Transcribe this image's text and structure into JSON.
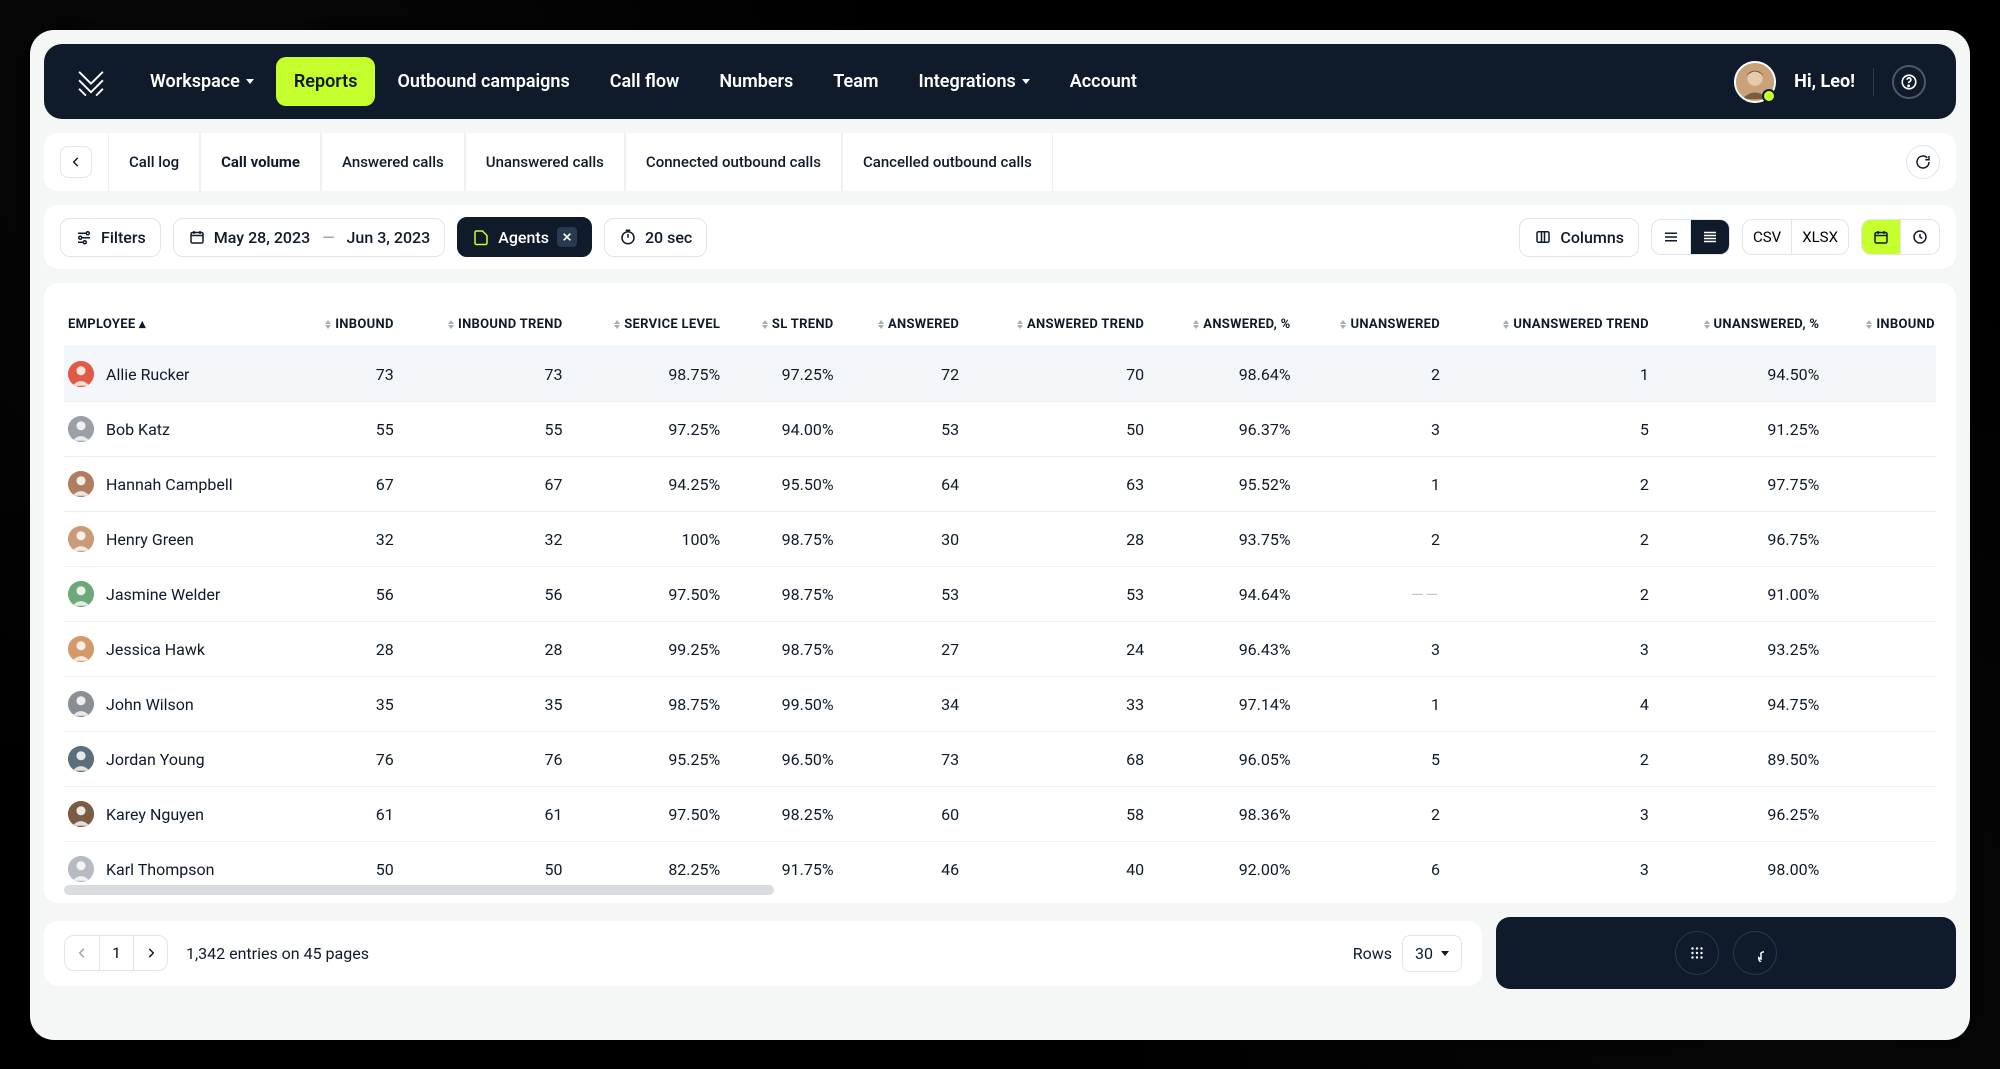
{
  "topnav": {
    "items": [
      {
        "label": "Workspace",
        "hasChevron": true
      },
      {
        "label": "Reports",
        "active": true
      },
      {
        "label": "Outbound campaigns"
      },
      {
        "label": "Call flow"
      },
      {
        "label": "Numbers"
      },
      {
        "label": "Team"
      },
      {
        "label": "Integrations",
        "hasChevron": true
      },
      {
        "label": "Account"
      }
    ],
    "greeting": "Hi, Leo!"
  },
  "tabs": [
    {
      "label": "Call log"
    },
    {
      "label": "Call volume",
      "active": true
    },
    {
      "label": "Answered calls"
    },
    {
      "label": "Unanswered calls"
    },
    {
      "label": "Connected outbound calls"
    },
    {
      "label": "Cancelled outbound calls"
    }
  ],
  "filters": {
    "filters_label": "Filters",
    "date_from": "May 28, 2023",
    "date_to": "Jun 3, 2023",
    "agents_label": "Agents",
    "duration_label": "20 sec",
    "columns_label": "Columns",
    "export": {
      "csv": "CSV",
      "xlsx": "XLSX"
    }
  },
  "table": {
    "columns": [
      {
        "key": "employee",
        "label": "EMPLOYEE",
        "sorted": true
      },
      {
        "key": "inbound",
        "label": "INBOUND"
      },
      {
        "key": "inbound_trend",
        "label": "INBOUND TREND"
      },
      {
        "key": "service_level",
        "label": "SERVICE LEVEL"
      },
      {
        "key": "sl_trend",
        "label": "SL TREND"
      },
      {
        "key": "answered",
        "label": "ANSWERED"
      },
      {
        "key": "answered_trend",
        "label": "ANSWERED TREND"
      },
      {
        "key": "answered_pct",
        "label": "ANSWERED, %"
      },
      {
        "key": "unanswered",
        "label": "UNANSWERED"
      },
      {
        "key": "unanswered_trend",
        "label": "UNANSWERED TREND"
      },
      {
        "key": "unanswered_pct",
        "label": "UNANSWERED, %"
      },
      {
        "key": "inbound_cc",
        "label": "INBOUND CC"
      }
    ],
    "rows": [
      {
        "employee": "Allie Rucker",
        "hue": "#e05a47",
        "inbound": 73,
        "inbound_trend": 73,
        "service_level": "98.75%",
        "sl_trend": "97.25%",
        "answered": 72,
        "answered_trend": 70,
        "answered_pct": "98.64%",
        "unanswered": 2,
        "unanswered_trend": "1",
        "unanswered_pct": "94.50%"
      },
      {
        "employee": "Bob Katz",
        "hue": "#9aa0a6",
        "inbound": 55,
        "inbound_trend": 55,
        "service_level": "97.25%",
        "sl_trend": "94.00%",
        "answered": 53,
        "answered_trend": 50,
        "answered_pct": "96.37%",
        "unanswered": 3,
        "unanswered_trend": "5",
        "unanswered_pct": "91.25%"
      },
      {
        "employee": "Hannah Campbell",
        "hue": "#b07d62",
        "inbound": 67,
        "inbound_trend": 67,
        "service_level": "94.25%",
        "sl_trend": "95.50%",
        "answered": 64,
        "answered_trend": 63,
        "answered_pct": "95.52%",
        "unanswered": 1,
        "unanswered_trend": "2",
        "unanswered_pct": "97.75%"
      },
      {
        "employee": "Henry Green",
        "hue": "#c99b78",
        "inbound": 32,
        "inbound_trend": 32,
        "service_level": "100%",
        "sl_trend": "98.75%",
        "answered": 30,
        "answered_trend": 28,
        "answered_pct": "93.75%",
        "unanswered": 2,
        "unanswered_trend": "2",
        "unanswered_pct": "96.75%"
      },
      {
        "employee": "Jasmine Welder",
        "hue": "#6da87b",
        "inbound": 56,
        "inbound_trend": 56,
        "service_level": "97.50%",
        "sl_trend": "98.75%",
        "answered": 53,
        "answered_trend": 53,
        "answered_pct": "94.64%",
        "unanswered": "—",
        "unanswered_trend": "2",
        "unanswered_pct": "91.00%"
      },
      {
        "employee": "Jessica Hawk",
        "hue": "#d49a6a",
        "inbound": 28,
        "inbound_trend": 28,
        "service_level": "99.25%",
        "sl_trend": "98.75%",
        "answered": 27,
        "answered_trend": 24,
        "answered_pct": "96.43%",
        "unanswered": 3,
        "unanswered_trend": "3",
        "unanswered_pct": "93.25%"
      },
      {
        "employee": "John Wilson",
        "hue": "#8a8f95",
        "inbound": 35,
        "inbound_trend": 35,
        "service_level": "98.75%",
        "sl_trend": "99.50%",
        "answered": 34,
        "answered_trend": 33,
        "answered_pct": "97.14%",
        "unanswered": 1,
        "unanswered_trend": "4",
        "unanswered_pct": "94.75%"
      },
      {
        "employee": "Jordan Young",
        "hue": "#5a6e7c",
        "inbound": 76,
        "inbound_trend": 76,
        "service_level": "95.25%",
        "sl_trend": "96.50%",
        "answered": 73,
        "answered_trend": 68,
        "answered_pct": "96.05%",
        "unanswered": 5,
        "unanswered_trend": "2",
        "unanswered_pct": "89.50%"
      },
      {
        "employee": "Karey Nguyen",
        "hue": "#7a5c45",
        "inbound": 61,
        "inbound_trend": 61,
        "service_level": "97.50%",
        "sl_trend": "98.25%",
        "answered": 60,
        "answered_trend": 58,
        "answered_pct": "98.36%",
        "unanswered": 2,
        "unanswered_trend": "3",
        "unanswered_pct": "96.25%"
      },
      {
        "employee": "Karl Thompson",
        "hue": "#b5bbc0",
        "inbound": 50,
        "inbound_trend": 50,
        "service_level": "82.25%",
        "sl_trend": "91.75%",
        "answered": 46,
        "answered_trend": 40,
        "answered_pct": "92.00%",
        "unanswered": 6,
        "unanswered_trend": "3",
        "unanswered_pct": "98.00%"
      }
    ]
  },
  "pager": {
    "current": "1",
    "info": "1,342 entries on 45 pages",
    "rows_label": "Rows",
    "rows_value": "30"
  }
}
